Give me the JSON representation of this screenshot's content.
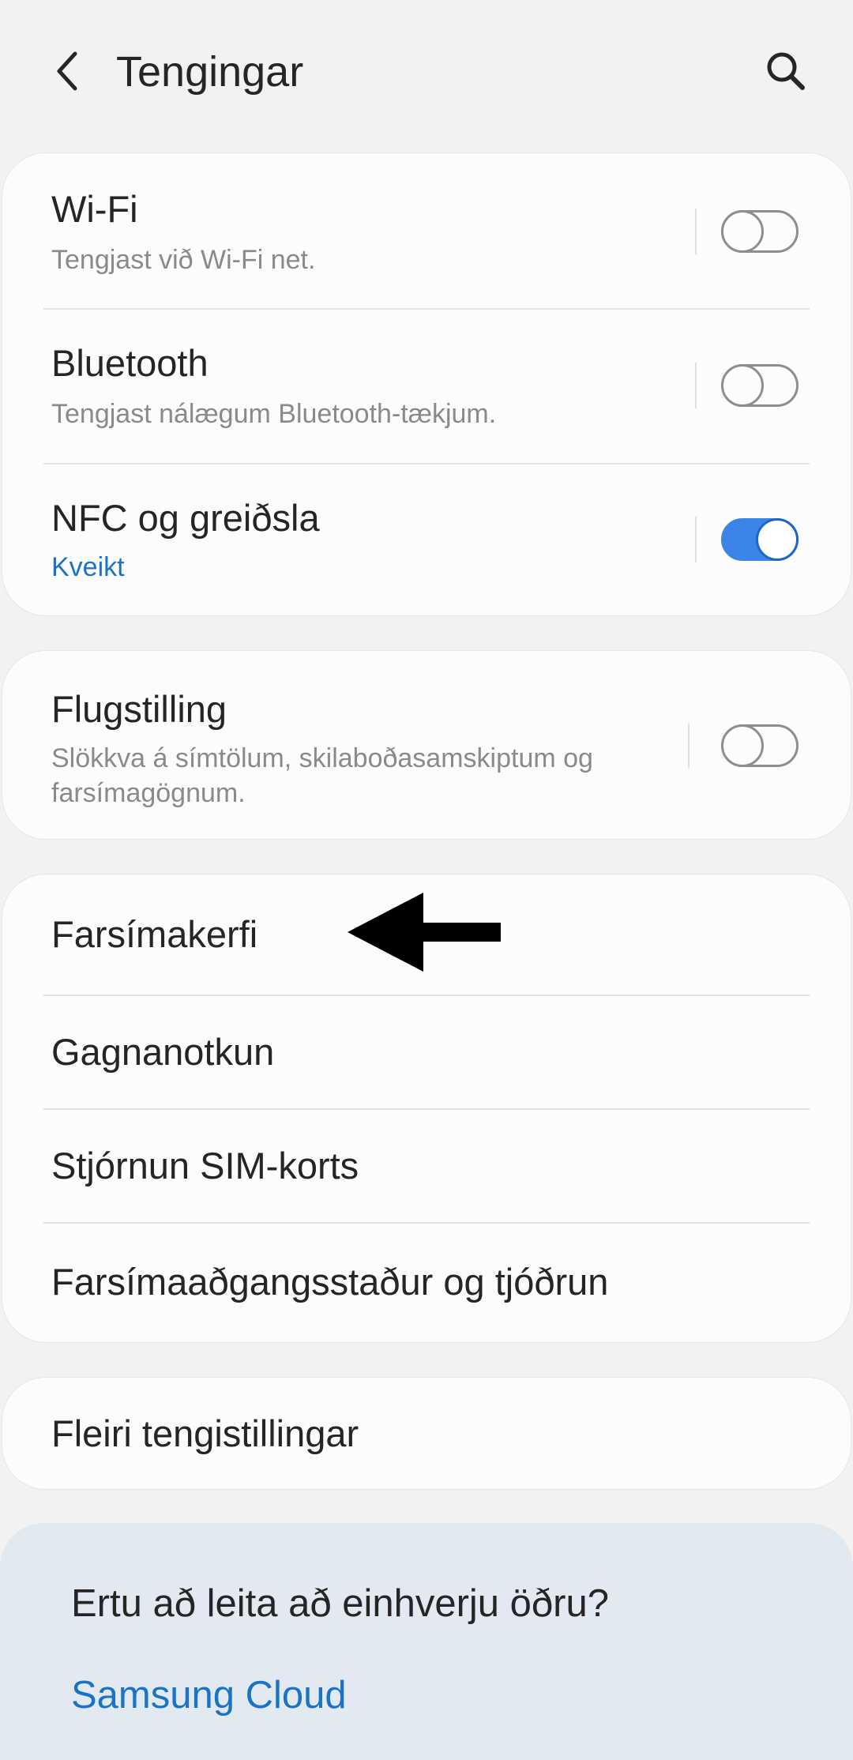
{
  "header": {
    "title": "Tengingar",
    "back_icon": "chevron-left-icon",
    "search_icon": "search-icon"
  },
  "card1": {
    "wifi": {
      "title": "Wi-Fi",
      "subtitle": "Tengjast við Wi-Fi net.",
      "enabled": false
    },
    "bluetooth": {
      "title": "Bluetooth",
      "subtitle": "Tengjast nálægum Bluetooth-tækjum.",
      "enabled": false
    },
    "nfc": {
      "title": "NFC og greiðsla",
      "subtitle": "Kveikt",
      "enabled": true
    }
  },
  "card2": {
    "airplane": {
      "title": "Flugstilling",
      "subtitle_line1": "Slökkva á símtölum, skilaboðasamskiptum og",
      "subtitle_line2": "farsímagögnum.",
      "enabled": false
    }
  },
  "card3": {
    "items": [
      {
        "label": "Farsímakerfi"
      },
      {
        "label": "Gagnanotkun"
      },
      {
        "label": "Stjórnun SIM-korts"
      },
      {
        "label": "Farsímaaðgangsstaður og tjóðrun"
      }
    ]
  },
  "card4": {
    "label": "Fleiri tengistillingar"
  },
  "suggest": {
    "title": "Ertu að leita að einhverju öðru?",
    "link": "Samsung Cloud"
  },
  "annotation": {
    "icon": "arrow-left-icon"
  },
  "colors": {
    "accent": "#3d84e8",
    "link": "#1a73c8",
    "background": "#f2f2f2"
  }
}
